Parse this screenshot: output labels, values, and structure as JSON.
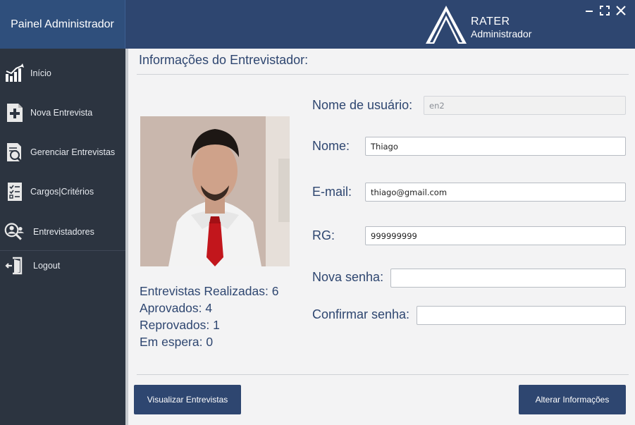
{
  "sidebar": {
    "title": "Painel Administrador",
    "items": [
      {
        "label": "Início",
        "icon": "chart-icon"
      },
      {
        "label": "Nova Entrevista",
        "icon": "add-document-icon"
      },
      {
        "label": "Gerenciar Entrevistas",
        "icon": "document-search-icon"
      },
      {
        "label": "Cargos|Critérios",
        "icon": "checklist-icon"
      },
      {
        "label": "Entrevistadores",
        "icon": "people-search-icon"
      },
      {
        "label": "Logout",
        "icon": "logout-icon"
      }
    ]
  },
  "header": {
    "brand_title": "RATER",
    "brand_subtitle": "Administrador",
    "window_controls": [
      "minimize-icon",
      "maximize-icon",
      "close-icon"
    ]
  },
  "main": {
    "section_title": "Informações do Entrevistador:",
    "stats": {
      "realizadas": "Entrevistas Realizadas: 6",
      "aprovados": "Aprovados: 4",
      "reprovados": "Reprovados: 1",
      "em_espera": "Em espera: 0"
    },
    "fields": {
      "usuario_label": "Nome de usuário:",
      "usuario_value": "en2",
      "nome_label": "Nome:",
      "nome_value": "Thiago",
      "email_label": "E-mail:",
      "email_value": "thiago@gmail.com",
      "rg_label": "RG:",
      "rg_value": "999999999",
      "nova_senha_label": "Nova senha:",
      "nova_senha_value": "",
      "confirmar_senha_label": "Confirmar senha:",
      "confirmar_senha_value": ""
    },
    "buttons": {
      "visualizar": "Visualizar Entrevistas",
      "alterar": "Alterar Informações"
    }
  },
  "colors": {
    "sidebar_bg": "#2c3440",
    "header_bg": "#2e4670",
    "accent": "#2f4f7c",
    "text_primary": "#2e4670"
  }
}
